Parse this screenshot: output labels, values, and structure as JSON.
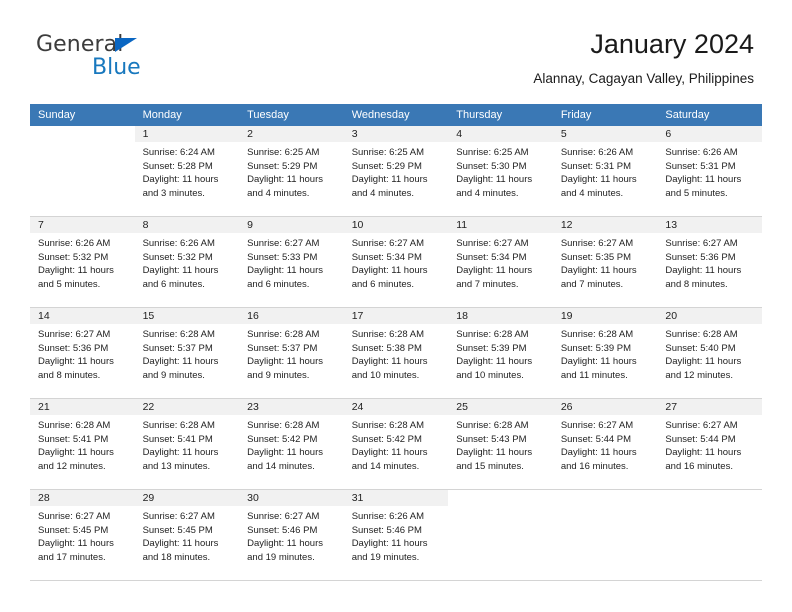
{
  "brand": {
    "name_top": "General",
    "name_bottom": "Blue",
    "triangle_color": "#0a66c2",
    "blue_text_color": "#1878be"
  },
  "header": {
    "title": "January 2024",
    "location": "Alannay, Cagayan Valley, Philippines"
  },
  "theme": {
    "header_row_bg": "#3a78b5",
    "daynum_band_bg": "#f1f1f1",
    "grid_line": "#d4d4d4",
    "text": "#1f1f1f"
  },
  "weekday_headers": [
    "Sunday",
    "Monday",
    "Tuesday",
    "Wednesday",
    "Thursday",
    "Friday",
    "Saturday"
  ],
  "labels": {
    "sunrise_prefix": "Sunrise:",
    "sunset_prefix": "Sunset:",
    "daylight_prefix": "Daylight:"
  },
  "weeks": [
    [
      {
        "day": "",
        "sunrise": "",
        "sunset": "",
        "daylight": "",
        "empty": true
      },
      {
        "day": "1",
        "sunrise": "Sunrise: 6:24 AM",
        "sunset": "Sunset: 5:28 PM",
        "daylight": "Daylight: 11 hours and 3 minutes."
      },
      {
        "day": "2",
        "sunrise": "Sunrise: 6:25 AM",
        "sunset": "Sunset: 5:29 PM",
        "daylight": "Daylight: 11 hours and 4 minutes."
      },
      {
        "day": "3",
        "sunrise": "Sunrise: 6:25 AM",
        "sunset": "Sunset: 5:29 PM",
        "daylight": "Daylight: 11 hours and 4 minutes."
      },
      {
        "day": "4",
        "sunrise": "Sunrise: 6:25 AM",
        "sunset": "Sunset: 5:30 PM",
        "daylight": "Daylight: 11 hours and 4 minutes."
      },
      {
        "day": "5",
        "sunrise": "Sunrise: 6:26 AM",
        "sunset": "Sunset: 5:31 PM",
        "daylight": "Daylight: 11 hours and 4 minutes."
      },
      {
        "day": "6",
        "sunrise": "Sunrise: 6:26 AM",
        "sunset": "Sunset: 5:31 PM",
        "daylight": "Daylight: 11 hours and 5 minutes."
      }
    ],
    [
      {
        "day": "7",
        "sunrise": "Sunrise: 6:26 AM",
        "sunset": "Sunset: 5:32 PM",
        "daylight": "Daylight: 11 hours and 5 minutes."
      },
      {
        "day": "8",
        "sunrise": "Sunrise: 6:26 AM",
        "sunset": "Sunset: 5:32 PM",
        "daylight": "Daylight: 11 hours and 6 minutes."
      },
      {
        "day": "9",
        "sunrise": "Sunrise: 6:27 AM",
        "sunset": "Sunset: 5:33 PM",
        "daylight": "Daylight: 11 hours and 6 minutes."
      },
      {
        "day": "10",
        "sunrise": "Sunrise: 6:27 AM",
        "sunset": "Sunset: 5:34 PM",
        "daylight": "Daylight: 11 hours and 6 minutes."
      },
      {
        "day": "11",
        "sunrise": "Sunrise: 6:27 AM",
        "sunset": "Sunset: 5:34 PM",
        "daylight": "Daylight: 11 hours and 7 minutes."
      },
      {
        "day": "12",
        "sunrise": "Sunrise: 6:27 AM",
        "sunset": "Sunset: 5:35 PM",
        "daylight": "Daylight: 11 hours and 7 minutes."
      },
      {
        "day": "13",
        "sunrise": "Sunrise: 6:27 AM",
        "sunset": "Sunset: 5:36 PM",
        "daylight": "Daylight: 11 hours and 8 minutes."
      }
    ],
    [
      {
        "day": "14",
        "sunrise": "Sunrise: 6:27 AM",
        "sunset": "Sunset: 5:36 PM",
        "daylight": "Daylight: 11 hours and 8 minutes."
      },
      {
        "day": "15",
        "sunrise": "Sunrise: 6:28 AM",
        "sunset": "Sunset: 5:37 PM",
        "daylight": "Daylight: 11 hours and 9 minutes."
      },
      {
        "day": "16",
        "sunrise": "Sunrise: 6:28 AM",
        "sunset": "Sunset: 5:37 PM",
        "daylight": "Daylight: 11 hours and 9 minutes."
      },
      {
        "day": "17",
        "sunrise": "Sunrise: 6:28 AM",
        "sunset": "Sunset: 5:38 PM",
        "daylight": "Daylight: 11 hours and 10 minutes."
      },
      {
        "day": "18",
        "sunrise": "Sunrise: 6:28 AM",
        "sunset": "Sunset: 5:39 PM",
        "daylight": "Daylight: 11 hours and 10 minutes."
      },
      {
        "day": "19",
        "sunrise": "Sunrise: 6:28 AM",
        "sunset": "Sunset: 5:39 PM",
        "daylight": "Daylight: 11 hours and 11 minutes."
      },
      {
        "day": "20",
        "sunrise": "Sunrise: 6:28 AM",
        "sunset": "Sunset: 5:40 PM",
        "daylight": "Daylight: 11 hours and 12 minutes."
      }
    ],
    [
      {
        "day": "21",
        "sunrise": "Sunrise: 6:28 AM",
        "sunset": "Sunset: 5:41 PM",
        "daylight": "Daylight: 11 hours and 12 minutes."
      },
      {
        "day": "22",
        "sunrise": "Sunrise: 6:28 AM",
        "sunset": "Sunset: 5:41 PM",
        "daylight": "Daylight: 11 hours and 13 minutes."
      },
      {
        "day": "23",
        "sunrise": "Sunrise: 6:28 AM",
        "sunset": "Sunset: 5:42 PM",
        "daylight": "Daylight: 11 hours and 14 minutes."
      },
      {
        "day": "24",
        "sunrise": "Sunrise: 6:28 AM",
        "sunset": "Sunset: 5:42 PM",
        "daylight": "Daylight: 11 hours and 14 minutes."
      },
      {
        "day": "25",
        "sunrise": "Sunrise: 6:28 AM",
        "sunset": "Sunset: 5:43 PM",
        "daylight": "Daylight: 11 hours and 15 minutes."
      },
      {
        "day": "26",
        "sunrise": "Sunrise: 6:27 AM",
        "sunset": "Sunset: 5:44 PM",
        "daylight": "Daylight: 11 hours and 16 minutes."
      },
      {
        "day": "27",
        "sunrise": "Sunrise: 6:27 AM",
        "sunset": "Sunset: 5:44 PM",
        "daylight": "Daylight: 11 hours and 16 minutes."
      }
    ],
    [
      {
        "day": "28",
        "sunrise": "Sunrise: 6:27 AM",
        "sunset": "Sunset: 5:45 PM",
        "daylight": "Daylight: 11 hours and 17 minutes."
      },
      {
        "day": "29",
        "sunrise": "Sunrise: 6:27 AM",
        "sunset": "Sunset: 5:45 PM",
        "daylight": "Daylight: 11 hours and 18 minutes."
      },
      {
        "day": "30",
        "sunrise": "Sunrise: 6:27 AM",
        "sunset": "Sunset: 5:46 PM",
        "daylight": "Daylight: 11 hours and 19 minutes."
      },
      {
        "day": "31",
        "sunrise": "Sunrise: 6:26 AM",
        "sunset": "Sunset: 5:46 PM",
        "daylight": "Daylight: 11 hours and 19 minutes."
      },
      {
        "day": "",
        "sunrise": "",
        "sunset": "",
        "daylight": "",
        "empty": true
      },
      {
        "day": "",
        "sunrise": "",
        "sunset": "",
        "daylight": "",
        "empty": true
      },
      {
        "day": "",
        "sunrise": "",
        "sunset": "",
        "daylight": "",
        "empty": true
      }
    ]
  ]
}
